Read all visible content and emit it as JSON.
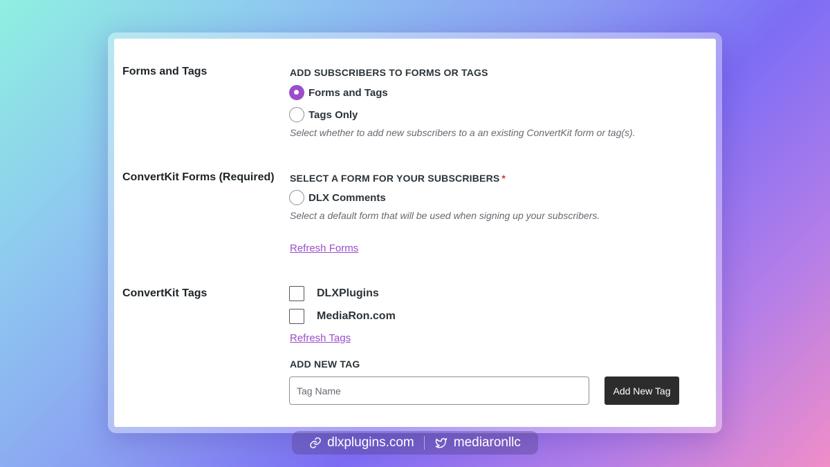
{
  "forms_and_tags": {
    "label": "Forms and Tags",
    "heading": "ADD SUBSCRIBERS TO FORMS OR TAGS",
    "options": [
      {
        "label": "Forms and Tags",
        "checked": true
      },
      {
        "label": "Tags Only",
        "checked": false
      }
    ],
    "description": "Select whether to add new subscribers to a an existing ConvertKit form or tag(s)."
  },
  "forms": {
    "label": "ConvertKit Forms (Required)",
    "heading": "SELECT A FORM FOR YOUR SUBSCRIBERS",
    "required_mark": "*",
    "options": [
      {
        "label": "DLX Comments",
        "checked": false
      }
    ],
    "description": "Select a default form that will be used when signing up your subscribers.",
    "refresh_link": "Refresh Forms"
  },
  "tags": {
    "label": "ConvertKit Tags",
    "items": [
      {
        "label": "DLXPlugins",
        "checked": false
      },
      {
        "label": "MediaRon.com",
        "checked": false
      }
    ],
    "refresh_link": "Refresh Tags",
    "add_heading": "ADD NEW TAG",
    "input_placeholder": "Tag Name",
    "input_value": "",
    "add_button": "Add New Tag"
  },
  "footer": {
    "website": "dlxplugins.com",
    "twitter": "mediaronllc"
  },
  "colors": {
    "accent": "#9b4dca",
    "button_bg": "#2c2c2c",
    "required": "#d63638"
  }
}
